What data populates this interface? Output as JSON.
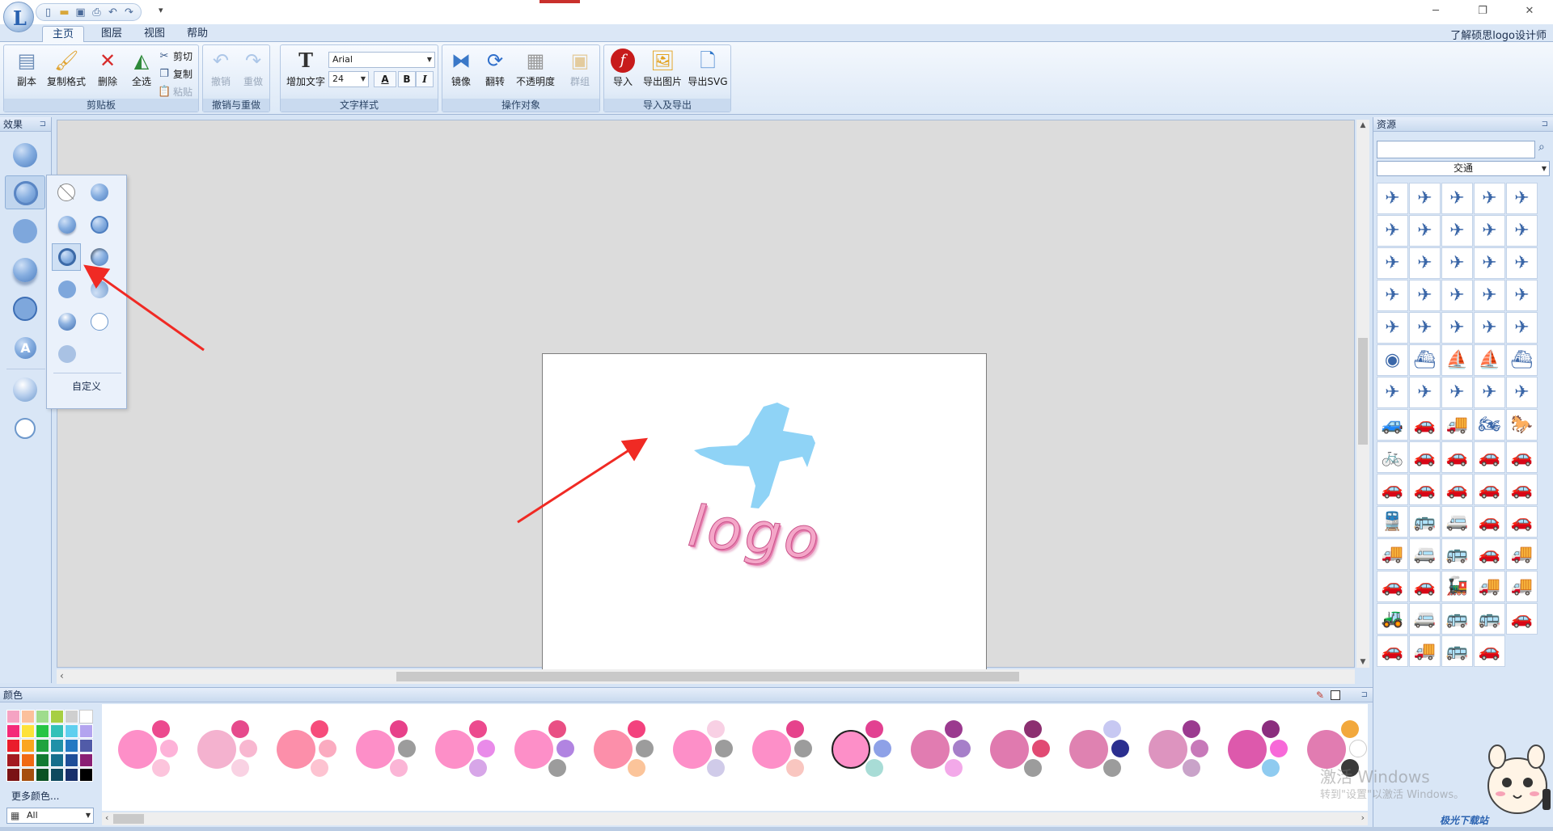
{
  "titlebar": {
    "quick_access": [
      "new-icon",
      "open-icon",
      "save-icon",
      "print-icon",
      "undo-icon",
      "redo-icon"
    ],
    "customize": "▾"
  },
  "tabs": [
    {
      "label": "主页",
      "active": true
    },
    {
      "label": "图层",
      "active": false
    },
    {
      "label": "视图",
      "active": false
    },
    {
      "label": "帮助",
      "active": false
    }
  ],
  "learn_link": "了解硕思logo设计师",
  "ribbon": {
    "clipboard": {
      "label": "剪贴板",
      "copy_doc": "副本",
      "format_painter": "复制格式",
      "delete": "删除",
      "select_all": "全选",
      "cut": "剪切",
      "copy": "复制",
      "paste": "粘贴"
    },
    "undo_redo": {
      "label": "撤销与重做",
      "undo": "撤销",
      "redo": "重做"
    },
    "text_style": {
      "label": "文字样式",
      "add_text": "增加文字",
      "font": "Arial",
      "size": "24",
      "bold": "B",
      "italic": "I",
      "stroke": "A"
    },
    "operate": {
      "label": "操作对象",
      "mirror": "镜像",
      "flip": "翻转",
      "opacity": "不透明度",
      "group": "群组"
    },
    "import_export": {
      "label": "导入及导出",
      "import": "导入",
      "export_image": "导出图片",
      "export_svg": "导出SVG"
    }
  },
  "effects_panel": {
    "title": "效果",
    "custom": "自定义",
    "pin": "⊐"
  },
  "artboard": {
    "logo_text": "logo"
  },
  "resources_panel": {
    "title": "资源",
    "search_placeholder": "",
    "category": "交通"
  },
  "colors_panel": {
    "title": "颜色",
    "more_colors": "更多颜色...",
    "filter": "All"
  },
  "palettes": [
    {
      "main": "#fd8fc8",
      "a": "#ec4a8e",
      "b": "#fdb2d8",
      "c": "#fcc4dc"
    },
    {
      "main": "#f4b2cf",
      "a": "#e64a8c",
      "b": "#f8b7d0",
      "c": "#f9d2e3"
    },
    {
      "main": "#fc8faa",
      "a": "#f64c7b",
      "b": "#fbabc0",
      "c": "#fdc3d1"
    },
    {
      "main": "#fd8fc8",
      "a": "#e7418a",
      "b": "#9c9c9c",
      "c": "#fbb5d6"
    },
    {
      "main": "#fd8fc8",
      "a": "#ec4a8e",
      "b": "#e98ae9",
      "c": "#d7a6e8"
    },
    {
      "main": "#fd8fc8",
      "a": "#e94f84",
      "b": "#b184e1",
      "c": "#9c9c9c"
    },
    {
      "main": "#fc8faa",
      "a": "#f3427e",
      "b": "#9c9c9c",
      "c": "#fbc49a"
    },
    {
      "main": "#fd8fc8",
      "a": "#f8d0e4",
      "b": "#9c9c9c",
      "c": "#d0cbe9"
    },
    {
      "main": "#fd8fc8",
      "a": "#e6438c",
      "b": "#9c9c9c",
      "c": "#f9c6c0"
    },
    {
      "main": "#fd8fc8",
      "a": "#e24191",
      "b": "#8ea1e7",
      "c": "#a8dcd6"
    },
    {
      "main": "#e17cb1",
      "a": "#9b3a8f",
      "b": "#a67fc9",
      "c": "#f3a9e9"
    },
    {
      "main": "#e07aaf",
      "a": "#8c2f70",
      "b": "#e14a73",
      "c": "#9c9c9c"
    },
    {
      "main": "#df82b1",
      "a": "#c7c8f2",
      "b": "#2b2f8f",
      "c": "#9c9c9c"
    },
    {
      "main": "#dd94bf",
      "a": "#9b3a8f",
      "b": "#c779b9",
      "c": "#c9a3c9"
    },
    {
      "main": "#dd59ac",
      "a": "#8b2d7e",
      "b": "#f769d8",
      "c": "#8fcbf0"
    },
    {
      "main": "#e17cb1",
      "a": "#f2a83c",
      "b": "#ffffff",
      "c": "#3a3a3a"
    }
  ],
  "swatch_colors": [
    "#f5a3c3",
    "#fbc09c",
    "#9fdc8d",
    "#a7cf43",
    "#cfcfcf",
    "#ffffff",
    "#f42a7a",
    "#fde23a",
    "#26c545",
    "#33c1b8",
    "#5fcfef",
    "#b3a4ef",
    "#ea1d2c",
    "#fba61f",
    "#1fa33e",
    "#2091a8",
    "#2379c3",
    "#515ba8",
    "#a31a21",
    "#f06a13",
    "#127a31",
    "#156e8c",
    "#1e4e99",
    "#8a1f74",
    "#7a1315",
    "#a5500f",
    "#0b5224",
    "#0e4a5f",
    "#18306b",
    "#000000"
  ],
  "resource_icons": [
    "✈",
    "✈",
    "✈",
    "✈",
    "✈",
    "✈",
    "✈",
    "✈",
    "✈",
    "✈",
    "✈",
    "✈",
    "✈",
    "✈",
    "✈",
    "✈",
    "✈",
    "✈",
    "✈",
    "✈",
    "✈",
    "✈",
    "✈",
    "✈",
    "✈",
    "◉",
    "⛴",
    "⛵",
    "⛵",
    "⛴",
    "✈",
    "✈",
    "✈",
    "✈",
    "✈",
    "🚙",
    "🚗",
    "🚚",
    "🏍",
    "🐎",
    "🚲",
    "🚗",
    "🚗",
    "🚗",
    "🚗",
    "🚗",
    "🚗",
    "🚗",
    "🚗",
    "🚗",
    "🚆",
    "🚌",
    "🚐",
    "🚗",
    "🚗",
    "🚚",
    "🚐",
    "🚌",
    "🚗",
    "🚚",
    "🚗",
    "🚗",
    "🚂",
    "🚚",
    "🚚",
    "🚜",
    "🚐",
    "🚌",
    "🚌",
    "🚗",
    "🚗",
    "🚚",
    "🚌",
    "🚗"
  ],
  "watermark": {
    "line1": "激活 Windows",
    "line2": "转到\"设置\"以激活 Windows。",
    "site": "极光下载站"
  }
}
